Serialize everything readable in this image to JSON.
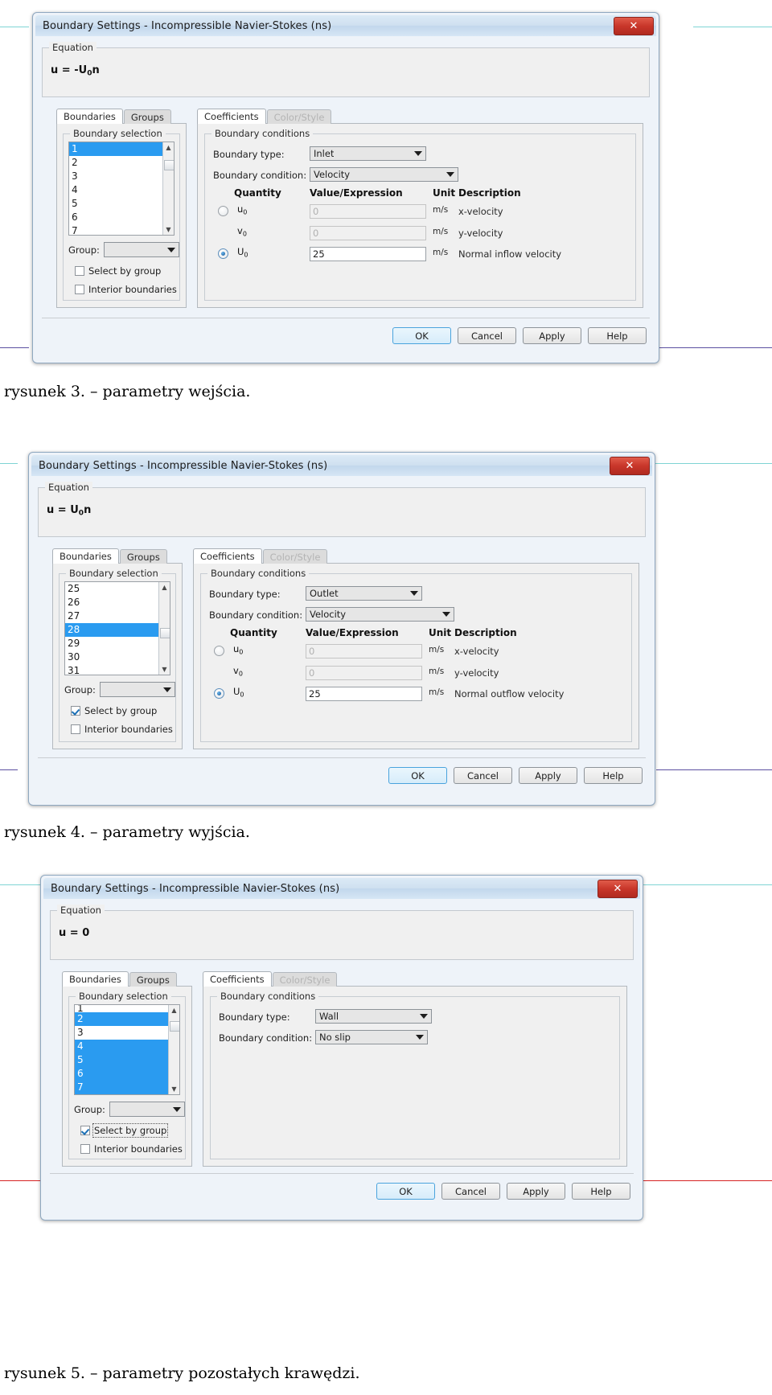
{
  "page": {
    "captions": [
      {
        "text": "rysunek 3. – parametry wejścia."
      },
      {
        "text": "rysunek 4. – parametry wyjścia."
      },
      {
        "text": "rysunek 5. – parametry pozostałych krawędzi."
      }
    ],
    "rules": [
      {
        "color": "#7fd4d4"
      },
      {
        "color": "#5b4fa0"
      },
      {
        "color": "#7fd4d4"
      },
      {
        "color": "#5b4fa0"
      },
      {
        "color": "#7fd4d4"
      },
      {
        "color": "#d62222"
      }
    ]
  },
  "common": {
    "title": "Boundary Settings - Incompressible Navier-Stokes (ns)",
    "close_label": "✕",
    "equation_group_label": "Equation",
    "tabs_left": [
      {
        "label": "Boundaries",
        "active": true
      },
      {
        "label": "Groups",
        "active": false
      }
    ],
    "tabs_right": [
      {
        "label": "Coefficients",
        "active": true,
        "disabled": false
      },
      {
        "label": "Color/Style",
        "active": false,
        "disabled": true
      }
    ],
    "boundary_selection_label": "Boundary selection",
    "group_label": "Group:",
    "group_value": "",
    "select_by_group_label": "Select by group",
    "interior_boundaries_label": "Interior boundaries",
    "boundary_conditions_label": "Boundary conditions",
    "boundary_type_label": "Boundary type:",
    "boundary_condition_label": "Boundary condition:",
    "table_headers": {
      "quantity": "Quantity",
      "value": "Value/Expression",
      "unit": "Unit",
      "description": "Description"
    },
    "buttons": [
      {
        "label": "OK",
        "default": true
      },
      {
        "label": "Cancel",
        "default": false
      },
      {
        "label": "Apply",
        "default": false
      },
      {
        "label": "Help",
        "default": false
      }
    ],
    "colors": {
      "selection_blue": "#2a9bf0",
      "title_blue": "#c2d7ec",
      "close_red": "#c8362a",
      "default_button_border": "#4aa3dd"
    }
  },
  "dialog1": {
    "equation": {
      "lhs": "u",
      "eq": "=",
      "rhs_prefix": "-U",
      "rhs_sub": "0",
      "rhs_suffix": "n"
    },
    "boundary_list": [
      {
        "label": "1",
        "selected": true
      },
      {
        "label": "2",
        "selected": false
      },
      {
        "label": "3",
        "selected": false
      },
      {
        "label": "4",
        "selected": false
      },
      {
        "label": "5",
        "selected": false
      },
      {
        "label": "6",
        "selected": false
      },
      {
        "label": "7",
        "selected": false
      }
    ],
    "select_by_group_checked": false,
    "interior_boundaries_checked": false,
    "boundary_type": "Inlet",
    "boundary_condition": "Velocity",
    "rows": [
      {
        "quantity": "u",
        "sub": "0",
        "value": "0",
        "unit": "m/s",
        "description": "x-velocity",
        "radio": true,
        "radio_selected": false,
        "enabled": false
      },
      {
        "quantity": "v",
        "sub": "0",
        "value": "0",
        "unit": "m/s",
        "description": "y-velocity",
        "radio": false,
        "radio_selected": false,
        "enabled": false
      },
      {
        "quantity": "U",
        "sub": "0",
        "value": "25",
        "unit": "m/s",
        "description": "Normal inflow velocity",
        "radio": true,
        "radio_selected": true,
        "enabled": true
      }
    ]
  },
  "dialog2": {
    "equation": {
      "lhs": "u",
      "eq": "=",
      "rhs_prefix": "U",
      "rhs_sub": "0",
      "rhs_suffix": "n"
    },
    "boundary_list": [
      {
        "label": "25",
        "selected": false
      },
      {
        "label": "26",
        "selected": false
      },
      {
        "label": "27",
        "selected": false
      },
      {
        "label": "28",
        "selected": true
      },
      {
        "label": "29",
        "selected": false
      },
      {
        "label": "30",
        "selected": false
      },
      {
        "label": "31",
        "selected": false
      }
    ],
    "select_by_group_checked": true,
    "interior_boundaries_checked": false,
    "boundary_type": "Outlet",
    "boundary_condition": "Velocity",
    "rows": [
      {
        "quantity": "u",
        "sub": "0",
        "value": "0",
        "unit": "m/s",
        "description": "x-velocity",
        "radio": true,
        "radio_selected": false,
        "enabled": false
      },
      {
        "quantity": "v",
        "sub": "0",
        "value": "0",
        "unit": "m/s",
        "description": "y-velocity",
        "radio": false,
        "radio_selected": false,
        "enabled": false
      },
      {
        "quantity": "U",
        "sub": "0",
        "value": "25",
        "unit": "m/s",
        "description": "Normal outflow velocity",
        "radio": true,
        "radio_selected": true,
        "enabled": true
      }
    ]
  },
  "dialog3": {
    "equation": {
      "lhs": "u",
      "eq": "=",
      "rhs_prefix": "0",
      "rhs_sub": "",
      "rhs_suffix": ""
    },
    "boundary_list": [
      {
        "label": "1",
        "selected": false
      },
      {
        "label": "2",
        "selected": true
      },
      {
        "label": "3",
        "selected": false
      },
      {
        "label": "4",
        "selected": true
      },
      {
        "label": "5",
        "selected": true
      },
      {
        "label": "6",
        "selected": true
      },
      {
        "label": "7",
        "selected": true
      }
    ],
    "select_by_group_checked": true,
    "interior_boundaries_checked": false,
    "boundary_type": "Wall",
    "boundary_condition": "No slip",
    "rows": []
  }
}
